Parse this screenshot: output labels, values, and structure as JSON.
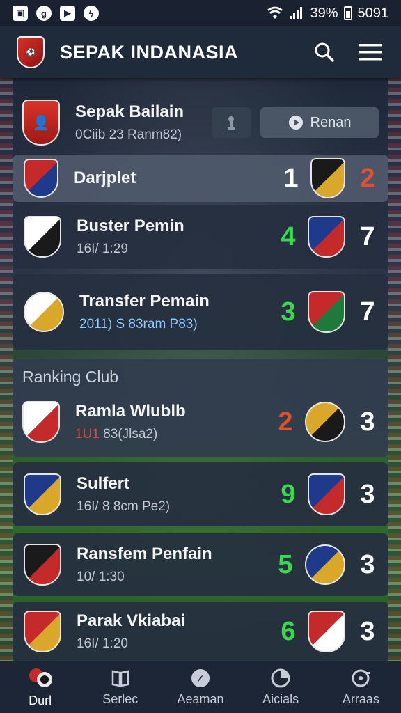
{
  "status_bar": {
    "battery": "39%",
    "time": "5091"
  },
  "header": {
    "title": "SEPAK INDANASIA"
  },
  "featured": {
    "name": "Sepak Bailain",
    "subtitle": "0Ciib 23 Ranm82)",
    "join_label": "Renan"
  },
  "matches": [
    {
      "name": "Darjplet",
      "sub": "",
      "score_home": "1",
      "score_away": "2",
      "home_color": "#ffffff",
      "away_color": "#e0512e",
      "crest_colors": [
        "#c52a2a",
        "#1f3a8a"
      ],
      "opp_colors": [
        "#1a1a1a",
        "#d9a82b"
      ]
    },
    {
      "name": "Buster Pemin",
      "sub": "16I/ 1:29",
      "score_home": "4",
      "score_away": "7",
      "home_color": "#39d84f",
      "away_color": "#ffffff",
      "crest_colors": [
        "#ffffff",
        "#1a1a1a"
      ],
      "opp_colors": [
        "#1f3a8a",
        "#c52a2a"
      ]
    },
    {
      "name": "Transfer Pemain",
      "sub": "2011) S 83ram P83)",
      "score_home": "3",
      "score_away": "7",
      "home_color": "#39d84f",
      "away_color": "#ffffff",
      "crest_colors": [
        "#ffffff",
        "#d9a82b"
      ],
      "opp_colors": [
        "#c52a2a",
        "#1e7a3a"
      ]
    }
  ],
  "ranking": {
    "title": "Ranking Club",
    "featured": {
      "name": "Ramla Wlublb",
      "sub_a": "1U1",
      "sub_b": "83(Jlsa2)",
      "score_home": "2",
      "score_away": "3",
      "home_color": "#e0512e",
      "away_color": "#ffffff",
      "crest_colors": [
        "#ffffff",
        "#c52a2a"
      ],
      "opp_colors": [
        "#d9a82b",
        "#1a1a1a"
      ]
    },
    "items": [
      {
        "name": "Sulfert",
        "sub": "16I/ 8 8cm Pe2)",
        "score_home": "9",
        "score_away": "3",
        "home_color": "#39d84f",
        "away_color": "#ffffff",
        "crest_colors": [
          "#1f3a8a",
          "#d9a82b"
        ],
        "opp_colors": [
          "#1f3a8a",
          "#c52a2a"
        ]
      },
      {
        "name": "Ransfem Penfain",
        "sub": "10/ 1:30",
        "score_home": "5",
        "score_away": "3",
        "home_color": "#39d84f",
        "away_color": "#ffffff",
        "crest_colors": [
          "#1a1a1a",
          "#c52a2a"
        ],
        "opp_colors": [
          "#1f3a8a",
          "#d9a82b"
        ]
      },
      {
        "name": "Parak Vkiabai",
        "sub": "16I/ 1:20",
        "score_home": "6",
        "score_away": "3",
        "home_color": "#39d84f",
        "away_color": "#ffffff",
        "crest_colors": [
          "#c52a2a",
          "#d9a82b"
        ],
        "opp_colors": [
          "#c52a2a",
          "#ffffff"
        ]
      }
    ]
  },
  "bottom_nav": [
    {
      "label": "Durl",
      "icon": "team-icon"
    },
    {
      "label": "Serlec",
      "icon": "book-icon"
    },
    {
      "label": "Aeaman",
      "icon": "compass-icon"
    },
    {
      "label": "Aicials",
      "icon": "chart-icon"
    },
    {
      "label": "Arraas",
      "icon": "settings-icon"
    }
  ]
}
